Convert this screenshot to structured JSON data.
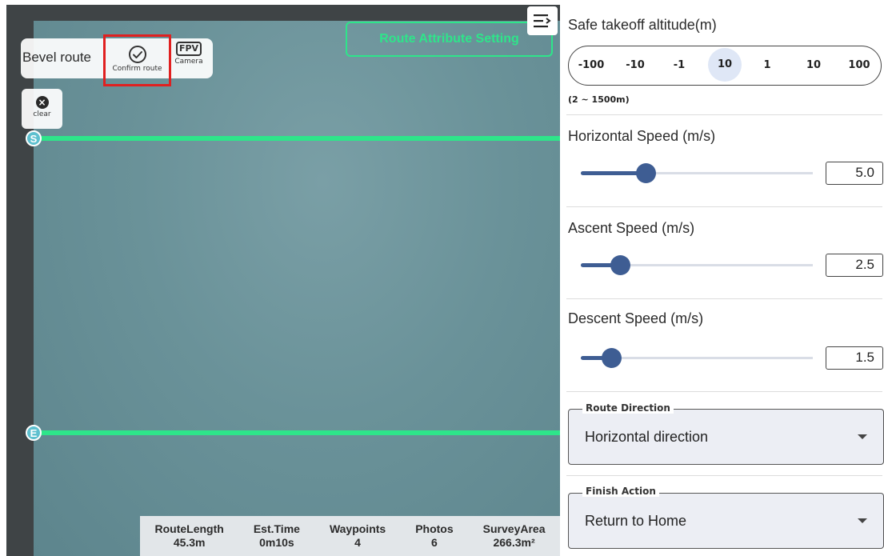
{
  "map": {
    "mode_label": "Bevel route",
    "confirm_label": "Confirm route",
    "camera_badge": "FPV",
    "camera_label": "Camera",
    "clear_label": "clear",
    "attr_button_label": "Route Attribute Setting",
    "start_marker": "S",
    "end_marker": "E",
    "route_color": "#2ee58a",
    "stats": [
      {
        "label": "RouteLength",
        "value": "45.3m"
      },
      {
        "label": "Est.Time",
        "value": "0m10s"
      },
      {
        "label": "Waypoints",
        "value": "4"
      },
      {
        "label": "Photos",
        "value": "6"
      },
      {
        "label": "SurveyArea",
        "value": "266.3m²"
      }
    ]
  },
  "panel": {
    "menu_icon": "collapse-menu-icon",
    "takeoff": {
      "title": "Safe takeoff altitude(m)",
      "options": [
        "-100",
        "-10",
        "-1",
        "10",
        "1",
        "10",
        "100"
      ],
      "selected_index": 3,
      "range": "(2 ~ 1500m)"
    },
    "horizontal_speed": {
      "title": "Horizontal Speed (m/s)",
      "value": "5.0",
      "level": 0.28
    },
    "ascent_speed": {
      "title": "Ascent Speed (m/s)",
      "value": "2.5",
      "level": 0.17
    },
    "descent_speed": {
      "title": "Descent Speed (m/s)",
      "value": "1.5",
      "level": 0.13
    },
    "route_direction": {
      "label": "Route Direction",
      "value": "Horizontal direction"
    },
    "finish_action": {
      "label": "Finish Action",
      "value": "Return to Home"
    },
    "accent_color": "#3e5d93"
  }
}
